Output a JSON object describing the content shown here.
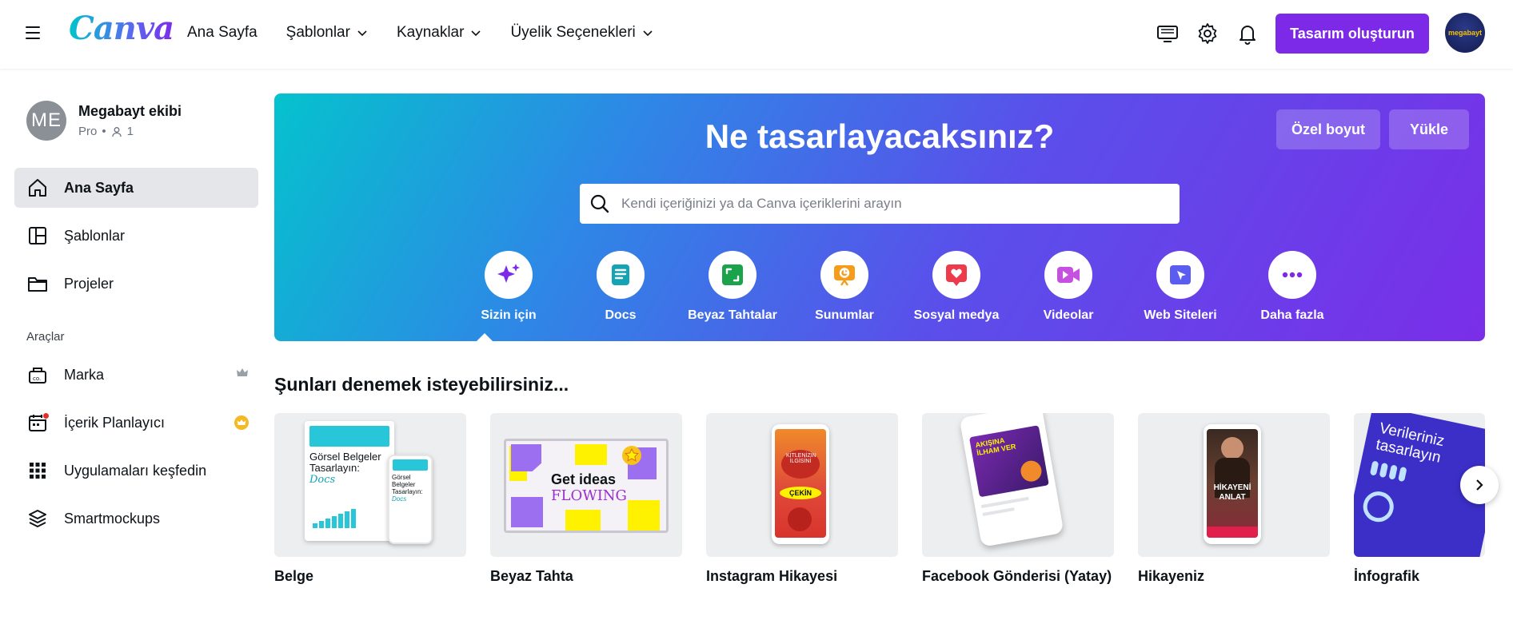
{
  "header": {
    "logo": "Canva",
    "nav": [
      {
        "label": "Ana Sayfa",
        "has_dropdown": false
      },
      {
        "label": "Şablonlar",
        "has_dropdown": true
      },
      {
        "label": "Kaynaklar",
        "has_dropdown": true
      },
      {
        "label": "Üyelik Seçenekleri",
        "has_dropdown": true
      }
    ],
    "icons": [
      "monitor-icon",
      "gear-icon",
      "bell-icon"
    ],
    "create_button": "Tasarım oluşturun",
    "avatar_text": "megabayt"
  },
  "sidebar": {
    "team": {
      "initials": "ME",
      "name": "Megabayt ekibi",
      "plan": "Pro",
      "member_count": "1"
    },
    "items": [
      {
        "label": "Ana Sayfa",
        "icon": "home-icon",
        "active": true
      },
      {
        "label": "Şablonlar",
        "icon": "templates-icon",
        "active": false
      },
      {
        "label": "Projeler",
        "icon": "folder-icon",
        "active": false
      }
    ],
    "tools_label": "Araçlar",
    "tools": [
      {
        "label": "Marka",
        "icon": "brand-kit-icon",
        "trail": "crown-icon"
      },
      {
        "label": "İçerik Planlayıcı",
        "icon": "calendar-icon",
        "trail": "pro-badge-icon"
      },
      {
        "label": "Uygulamaları keşfedin",
        "icon": "apps-grid-icon",
        "trail": ""
      },
      {
        "label": "Smartmockups",
        "icon": "layers-icon",
        "trail": ""
      }
    ]
  },
  "hero": {
    "title": "Ne tasarlayacaksınız?",
    "custom_size_button": "Özel boyut",
    "upload_button": "Yükle",
    "search_placeholder": "Kendi içeriğinizi ya da Canva içeriklerini arayın",
    "categories": [
      {
        "label": "Sizin için",
        "icon": "sparkles-icon",
        "color": "#7d2ae8",
        "selected": true
      },
      {
        "label": "Docs",
        "icon": "docs-icon",
        "color": "#13a3b5",
        "selected": false
      },
      {
        "label": "Beyaz Tahtalar",
        "icon": "whiteboard-icon",
        "color": "#1aa34a",
        "selected": false
      },
      {
        "label": "Sunumlar",
        "icon": "presentation-icon",
        "color": "#f59c1a",
        "selected": false
      },
      {
        "label": "Sosyal medya",
        "icon": "heart-icon",
        "color": "#ed3b4b",
        "selected": false
      },
      {
        "label": "Videolar",
        "icon": "video-icon",
        "color": "#c650e0",
        "selected": false
      },
      {
        "label": "Web Siteleri",
        "icon": "website-icon",
        "color": "#5b5cf0",
        "selected": false
      },
      {
        "label": "Daha fazla",
        "icon": "more-icon",
        "color": "#7d2ae8",
        "selected": false
      }
    ]
  },
  "suggestions": {
    "title": "Şunları denemek isteyebilirsiniz...",
    "cards": [
      {
        "label": "Belge",
        "thumb_text_1": "Görsel Belgeler Tasarlayın:",
        "thumb_text_2": "Docs"
      },
      {
        "label": "Beyaz Tahta",
        "thumb_text_1": "Get ideas",
        "thumb_text_2": "FLOWING"
      },
      {
        "label": "Instagram Hikayesi",
        "thumb_text_1": "ÇEKİN"
      },
      {
        "label": "Facebook Gönderisi (Yatay)",
        "thumb_text_1": "AKIŞINA İLHAM VER"
      },
      {
        "label": "Hikayeniz",
        "thumb_text_1": "HİKAYENİ ANLAT"
      },
      {
        "label": "İnfografik",
        "thumb_text_1": "Verileriniz tasarlayın"
      }
    ]
  },
  "colors": {
    "brand_purple": "#7d2ae8",
    "hero_start": "#05c2cd",
    "hero_end": "#7a2ee8"
  }
}
